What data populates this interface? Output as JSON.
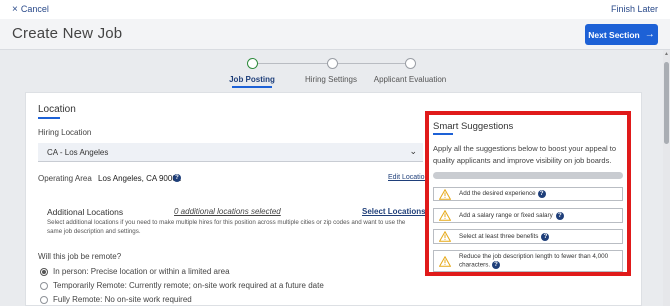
{
  "topbar": {
    "cancel_label": "Cancel",
    "finish_label": "Finish Later"
  },
  "header": {
    "title": "Create New Job",
    "next_label": "Next Section"
  },
  "steps": [
    {
      "label": "Job Posting",
      "active": true
    },
    {
      "label": "Hiring Settings",
      "active": false
    },
    {
      "label": "Applicant Evaluation",
      "active": false
    }
  ],
  "location": {
    "title": "Location",
    "hiring_location_label": "Hiring Location",
    "hiring_location_value": "CA - Los Angeles",
    "operating_area_label": "Operating Area",
    "operating_area_value": "Los Angeles, CA 90001",
    "edit_location_label": "Edit Location",
    "additional_title": "Additional Locations",
    "additional_count": "0 additional locations selected",
    "additional_link": "Select Locations",
    "additional_desc": "Select additional locations if you need to make multiple hires for this position across multiple cities or zip codes and want to use the same job description and settings.",
    "remote_question": "Will this job be remote?",
    "remote_options": [
      {
        "label": "In person: Precise location or within a limited area",
        "selected": true
      },
      {
        "label": "Temporarily Remote: Currently remote; on-site work required at a future date",
        "selected": false
      },
      {
        "label": "Fully Remote: No on-site work required",
        "selected": false
      }
    ]
  },
  "smart": {
    "title": "Smart Suggestions",
    "description": "Apply all the suggestions below to boost your appeal to quality applicants and improve visibility on job boards.",
    "suggestions": [
      {
        "text": "Add the desired experience"
      },
      {
        "text": "Add a salary range or fixed salary"
      },
      {
        "text": "Select at least three benefits"
      },
      {
        "text": "Reduce the job description length to fewer than 4,000 characters."
      }
    ]
  },
  "colors": {
    "accent": "#1d61d6",
    "highlight": "#e01a1a",
    "active_step": "#2e8b3c",
    "warning": "#e6a817"
  },
  "icons": [
    "close-icon",
    "arrow-right-icon",
    "chevron-down-icon",
    "help-icon",
    "warning-icon"
  ]
}
